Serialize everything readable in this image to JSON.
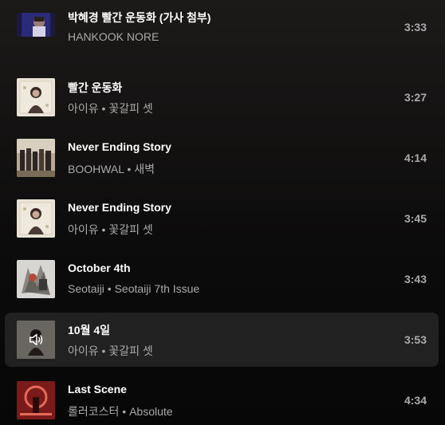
{
  "tracks": [
    {
      "title": "박혜경 빨간 운동화 (가사 첨부)",
      "subtitle": "HANKOOK NORE",
      "duration": "3:33",
      "art": "video-thumb"
    },
    {
      "title": "빨간 운동화",
      "subtitle": "아이유 • 꽃갈피 셋",
      "duration": "3:27",
      "art": "album-iu"
    },
    {
      "title": "Never Ending Story",
      "subtitle": "BOOHWAL • 새벽",
      "duration": "4:14",
      "art": "album-boohwal"
    },
    {
      "title": "Never Ending Story",
      "subtitle": "아이유 • 꽃갈피 셋",
      "duration": "3:45",
      "art": "album-iu"
    },
    {
      "title": "October 4th",
      "subtitle": "Seotaiji • Seotaiji 7th Issue",
      "duration": "3:43",
      "art": "album-seotaiji"
    },
    {
      "title": "10월 4일",
      "subtitle": "아이유 • 꽃갈피 셋",
      "duration": "3:53",
      "art": "album-iu",
      "now_playing": true,
      "icon": "speaker-icon"
    },
    {
      "title": "Last Scene",
      "subtitle": "롤러코스터 • Absolute",
      "duration": "4:34",
      "art": "album-rollercoaster"
    }
  ],
  "colors": {
    "title": "#ffffff",
    "subtitle": "#aaaaaa",
    "active_row": "#212121"
  }
}
